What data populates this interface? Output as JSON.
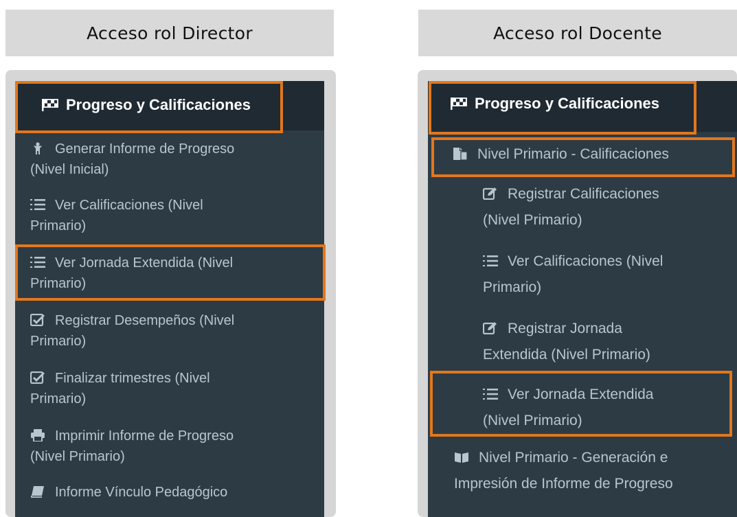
{
  "left": {
    "label": "Acceso rol Director",
    "header": "Progreso y Calificaciones",
    "items": [
      {
        "icon": "child-icon",
        "text": "Generar Informe de Progreso",
        "text2": "(Nivel Inicial)"
      },
      {
        "icon": "list-ol-icon",
        "text": "Ver Calificaciones (Nivel",
        "text2": "Primario)"
      },
      {
        "icon": "list-ol-icon",
        "text": "Ver Jornada Extendida (Nivel",
        "text2": "Primario)"
      },
      {
        "icon": "check-square-icon",
        "text": "Registrar Desempeños (Nivel",
        "text2": "Primario)"
      },
      {
        "icon": "check-square-icon",
        "text": "Finalizar trimestres (Nivel",
        "text2": "Primario)"
      },
      {
        "icon": "print-icon",
        "text": "Imprimir Informe de Progreso",
        "text2": "(Nivel Primario)"
      },
      {
        "icon": "book-icon",
        "text": "Informe Vínculo Pedagógico"
      }
    ]
  },
  "right": {
    "label": "Acceso rol Docente",
    "header": "Progreso y Calificaciones",
    "sub": "Nivel Primario - Calificaciones",
    "items": [
      {
        "icon": "edit-icon",
        "text": "Registrar Calificaciones",
        "text2": "(Nivel Primario)"
      },
      {
        "icon": "list-ol-icon",
        "text": "Ver Calificaciones (Nivel",
        "text2": "Primario)"
      },
      {
        "icon": "edit-icon",
        "text": "Registrar Jornada",
        "text2": "Extendida (Nivel Primario)"
      },
      {
        "icon": "list-ol-icon",
        "text": "Ver Jornada Extendida",
        "text2": "(Nivel Primario)"
      }
    ],
    "footer": {
      "icon": "book-open-icon",
      "text": "Nivel Primario - Generación e",
      "text2": "Impresión de Informe de Progreso"
    }
  },
  "colors": {
    "accent": "#e2771c",
    "sidebar_bg": "#2d3b45",
    "header_bg": "#1f2a33",
    "menu_text": "#b8c7ce"
  }
}
